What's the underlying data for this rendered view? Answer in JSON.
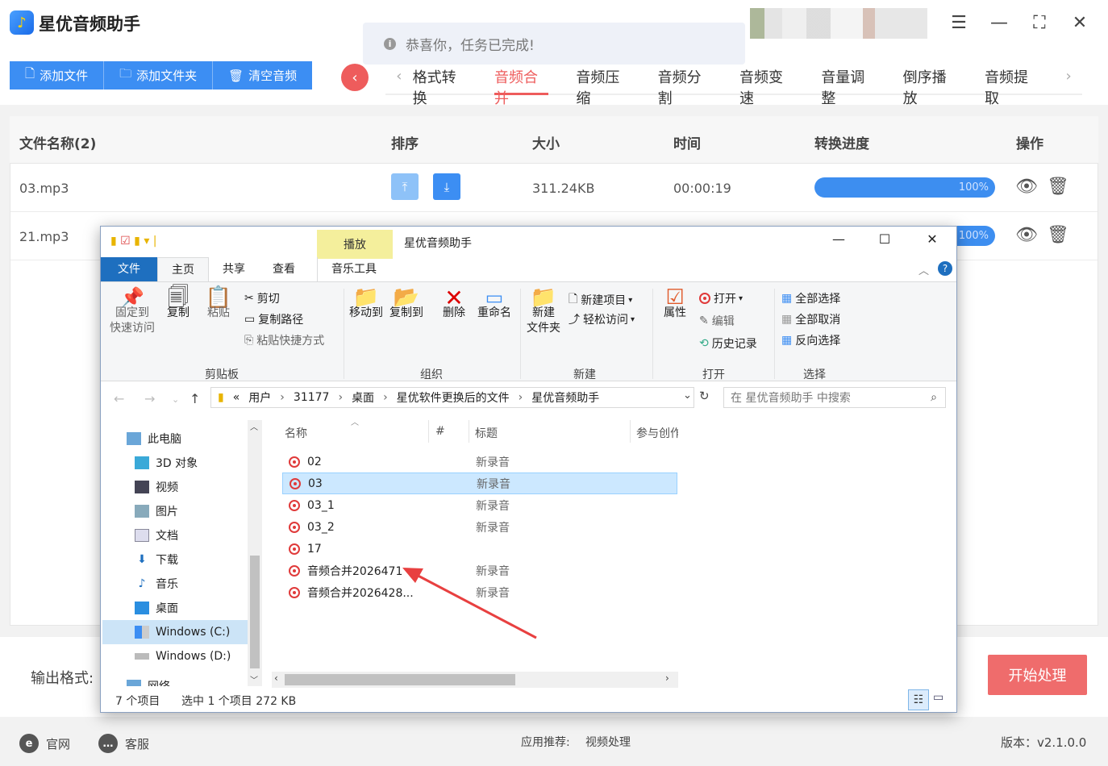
{
  "app": {
    "title": "星优音频助手",
    "logo_glyph": "♪"
  },
  "toast": {
    "icon": "i",
    "message": "恭喜你，任务已完成!"
  },
  "toolbar": {
    "add_file": "添加文件",
    "add_folder": "添加文件夹",
    "clear": "清空音频"
  },
  "nav_tabs": [
    "格式转换",
    "音频合并",
    "音频压缩",
    "音频分割",
    "音频变速",
    "音量调整",
    "倒序播放",
    "音频提取"
  ],
  "active_tab": "音频合并",
  "table": {
    "headers": {
      "name": "文件名称(2)",
      "sort": "排序",
      "size": "大小",
      "time": "时间",
      "progress": "转换进度",
      "ops": "操作"
    },
    "rows": [
      {
        "name": "03.mp3",
        "size": "311.24KB",
        "time": "00:00:19",
        "progress": "100%"
      },
      {
        "name": "21.mp3",
        "size": "",
        "time": "",
        "progress": "100%"
      }
    ]
  },
  "bottom": {
    "output_format_label": "输出格式:",
    "start_button": "开始处理"
  },
  "footer": {
    "website": "官网",
    "support": "客服",
    "recommend_label": "应用推荐:",
    "recommend_item": "视频处理",
    "version": "版本：v2.1.0.0"
  },
  "explorer": {
    "window_title": "星优音频助手",
    "play_tab": "播放",
    "menus": {
      "file": "文件",
      "home": "主页",
      "share": "共享",
      "view": "查看",
      "music_tools": "音乐工具"
    },
    "ribbon": {
      "pin": "固定到\n快速访问",
      "copy": "复制",
      "paste": "粘贴",
      "cut": "剪切",
      "copy_path": "复制路径",
      "paste_shortcut": "粘贴快捷方式",
      "clipboard": "剪贴板",
      "move_to": "移动到",
      "copy_to": "复制到",
      "delete": "删除",
      "rename": "重命名",
      "organize": "组织",
      "new_folder": "新建\n文件夹",
      "new_item": "新建项目",
      "easy_access": "轻松访问",
      "new": "新建",
      "properties": "属性",
      "open": "打开",
      "edit": "编辑",
      "history": "历史记录",
      "open_group": "打开",
      "select_all": "全部选择",
      "select_none": "全部取消",
      "invert": "反向选择",
      "select": "选择"
    },
    "address": [
      "«",
      "用户",
      "31177",
      "桌面",
      "星优软件更换后的文件",
      "星优音频助手"
    ],
    "search_placeholder": "在 星优音频助手 中搜索",
    "nav_items": [
      "此电脑",
      "3D 对象",
      "视频",
      "图片",
      "文档",
      "下载",
      "音乐",
      "桌面",
      "Windows (C:)",
      "Windows (D:)",
      "网络"
    ],
    "columns": {
      "name": "名称",
      "num": "#",
      "title": "标题",
      "contrib": "参与创作"
    },
    "files": [
      {
        "name": "02",
        "title": "新录音"
      },
      {
        "name": "03",
        "title": "新录音"
      },
      {
        "name": "03_1",
        "title": "新录音"
      },
      {
        "name": "03_2",
        "title": "新录音"
      },
      {
        "name": "17",
        "title": ""
      },
      {
        "name": "音频合并2026471",
        "title": "新录音"
      },
      {
        "name": "音频合并2026428...",
        "title": "新录音"
      }
    ],
    "status": {
      "count": "7 个项目",
      "selected": "选中 1 个项目  272 KB"
    }
  },
  "colors": {
    "accent_blue": "#3c8ef3",
    "accent_red": "#ee5c5c",
    "progress": "#3d8ef0",
    "selection": "#cce8ff"
  }
}
